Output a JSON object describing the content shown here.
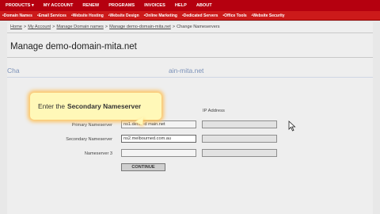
{
  "topnav": {
    "items": [
      "PRODUCTS ▾",
      "MY ACCOUNT",
      "RENEW",
      "PROGRAMS",
      "INVOICES",
      "HELP",
      "ABOUT"
    ]
  },
  "subnav": {
    "items": [
      "•Domain Names",
      "•Email Services",
      "•Website Hosting",
      "•Website Design",
      "•Online Marketing",
      "•Dedicated Servers",
      "•Office Tools",
      "•Website Security"
    ]
  },
  "breadcrumb": {
    "home": "Home",
    "my_account": "My Account",
    "manage_domains": "Manage Domain names",
    "manage_domain": "Manage demo-domain-mita.net",
    "current": "Change Nameservers",
    "sep": ">"
  },
  "page": {
    "title": "Manage demo-domain-mita.net",
    "section_title_left": "Cha",
    "section_title_right": "ain-mita.net"
  },
  "form": {
    "ip_header": "IP Address",
    "rows": [
      {
        "label": "Primary Nameserver",
        "value": "ns1.demo-d    main.net",
        "ip": ""
      },
      {
        "label": "Secondary Nameserver",
        "value": "ns2.melbourned.com.au",
        "ip": ""
      },
      {
        "label": "Nameserver 3",
        "value": "",
        "ip": ""
      }
    ],
    "continue_label": "CONTINUE"
  },
  "tooltip": {
    "prefix": "Enter the",
    "emphasis": "Secondary Nameserver"
  },
  "colors": {
    "topnav_bg": "#b5000f",
    "subnav_bg": "#cc1a1a",
    "section_title": "#7a90b8",
    "tooltip_bg": "#fff8b8"
  }
}
